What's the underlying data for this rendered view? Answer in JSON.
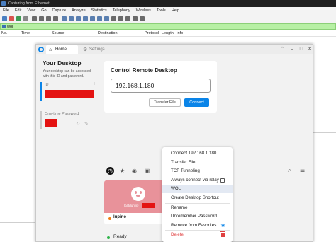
{
  "wireshark": {
    "title": "Capturing from Ethernet",
    "menu": [
      "File",
      "Edit",
      "View",
      "Go",
      "Capture",
      "Analyze",
      "Statistics",
      "Telephony",
      "Wireless",
      "Tools",
      "Help"
    ],
    "filter_text": "wol",
    "columns": [
      "No.",
      "Time",
      "Source",
      "Destination",
      "Protocol",
      "Length",
      "Info"
    ]
  },
  "rustdesk": {
    "tabs": {
      "home": "Home",
      "settings": "Settings"
    },
    "sidebar": {
      "title": "Your Desktop",
      "description": "Your desktop can be accessed with this ID and password.",
      "id_label": "ID",
      "password_label": "One-time Password"
    },
    "control": {
      "title": "Control Remote Desktop",
      "address_value": "192.168.1.180",
      "transfer_button": "Transfer File",
      "connect_button": "Connect"
    },
    "peer": {
      "hostname_prefix": "lbatdunt@",
      "name": "lupino",
      "status_color": "#f07c12"
    },
    "status": {
      "text": "Ready",
      "color": "#2fb44a"
    },
    "context_menu": {
      "connect": "Connect 192.168.1.180",
      "transfer": "Transfer File",
      "tcp": "TCP Tunneling",
      "relay": "Always connect via relay",
      "wol": "WOL",
      "shortcut": "Create Desktop Shortcut",
      "rename": "Rename",
      "unremember": "Unremember Password",
      "remove_fav": "Remove from Favorites",
      "delete": "Delete"
    },
    "accent_color": "#0a84e8",
    "redaction_color": "#e41312"
  }
}
